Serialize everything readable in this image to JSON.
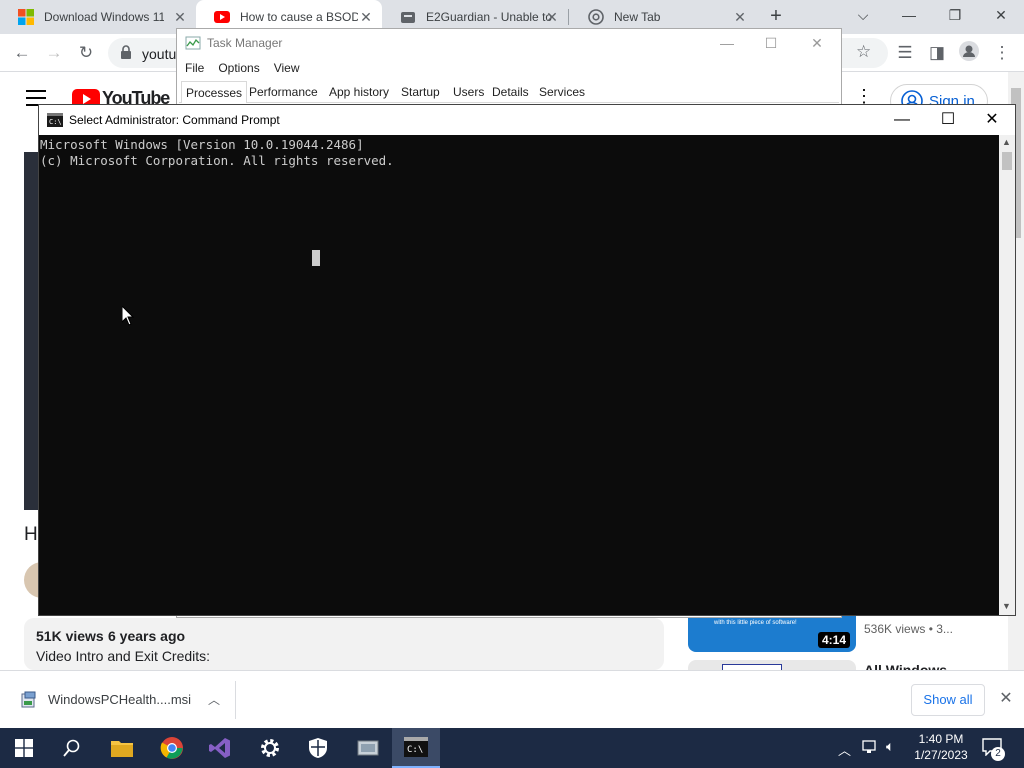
{
  "browser": {
    "tabs": [
      {
        "title": "Download Windows 11",
        "favicon": "windows-logo-icon"
      },
      {
        "title": "How to cause a BSOD",
        "favicon": "youtube-icon"
      },
      {
        "title": "E2Guardian - Unable to",
        "favicon": "e2guardian-icon"
      },
      {
        "title": "New Tab",
        "favicon": "chrome-icon"
      }
    ],
    "active_tab": 1,
    "omnibox_text": "youtu"
  },
  "youtube": {
    "logo_text": "YouTube",
    "sign_in_label": "Sign in",
    "video_title_fragment": "H",
    "views": "51K views",
    "age": "6 years ago",
    "description_line": "Video Intro and Exit Credits:",
    "sidebar": [
      {
        "duration": "4:14",
        "meta": "536K views  • 3...",
        "thumb_text": "with this little piece of software!"
      },
      {
        "title_fragment": "All Windows"
      }
    ]
  },
  "task_manager": {
    "title": "Task Manager",
    "menu": [
      "File",
      "Options",
      "View"
    ],
    "tabs": [
      "Processes",
      "Performance",
      "App history",
      "Startup",
      "Users",
      "Details",
      "Services"
    ],
    "active_tab": "Processes"
  },
  "cmd": {
    "title": "Select Administrator:  Command Prompt",
    "lines": [
      "Microsoft Windows [Version 10.0.19044.2486]",
      "(c) Microsoft Corporation. All rights reserved."
    ]
  },
  "download_shelf": {
    "filename": "WindowsPCHealth....msi",
    "show_all_label": "Show all"
  },
  "taskbar": {
    "time": "1:40 PM",
    "date": "1/27/2023",
    "notification_count": "2",
    "icons": [
      "start-icon",
      "search-icon",
      "file-explorer-icon",
      "chrome-icon",
      "visual-studio-icon",
      "settings-icon",
      "security-icon",
      "network-tool-icon",
      "command-prompt-icon"
    ]
  },
  "colors": {
    "taskbar": "#1c2a44",
    "console_bg": "#0c0c0c",
    "console_fg": "#cccccc",
    "accent": "#1a73e8",
    "youtube_red": "#ff0000"
  }
}
